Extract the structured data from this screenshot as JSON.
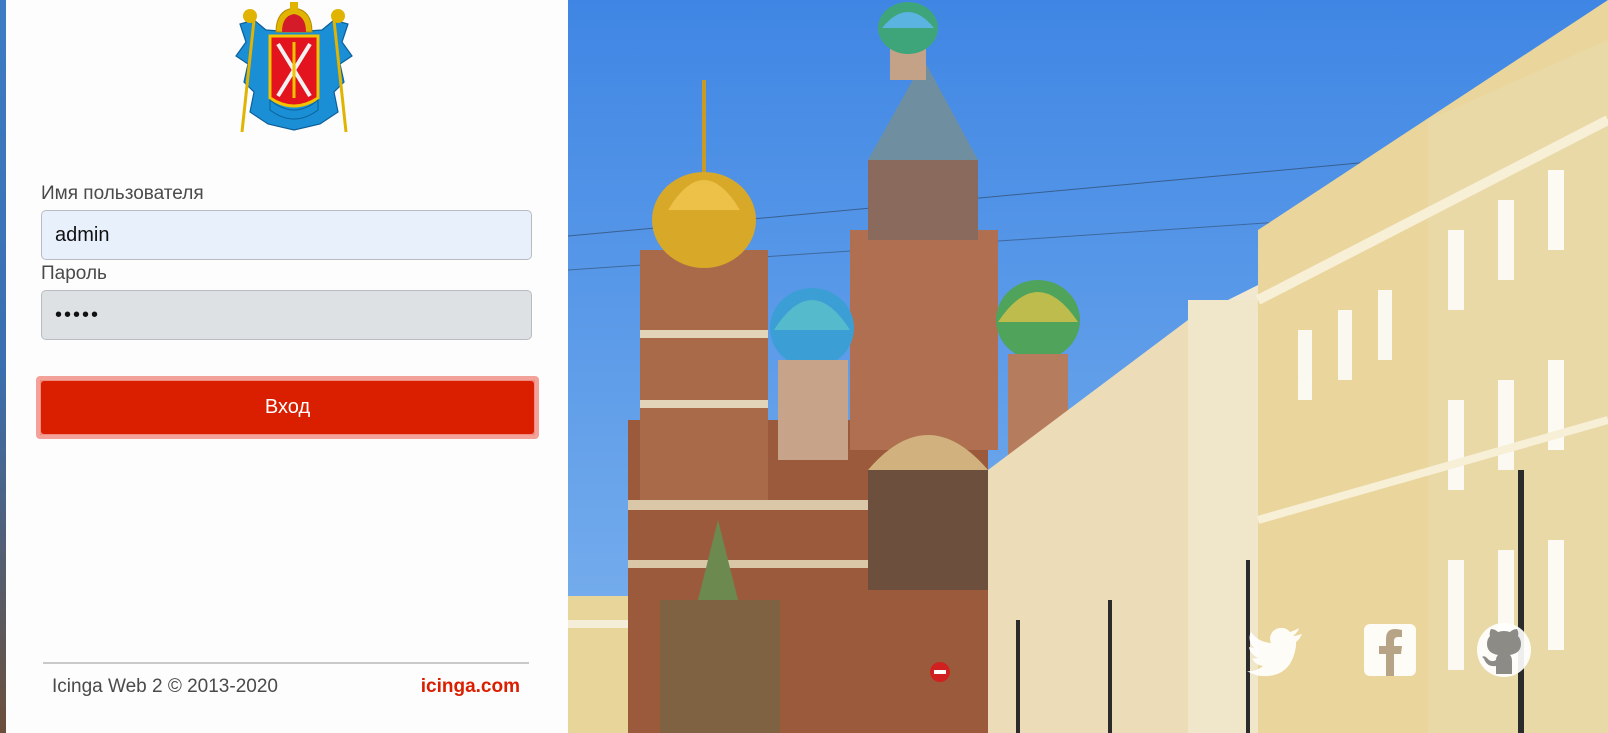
{
  "form": {
    "username_label": "Имя пользователя",
    "username_value": "admin",
    "password_label": "Пароль",
    "password_value": "•••••",
    "submit_label": "Вход"
  },
  "footer": {
    "copyright": "Icinga Web 2 © 2013-2020",
    "link_text": "icinga.com"
  },
  "social": [
    {
      "icon": "twitter-icon"
    },
    {
      "icon": "facebook-icon"
    },
    {
      "icon": "github-icon"
    }
  ],
  "colors": {
    "accent": "#da1e00",
    "input_username_bg": "#e8f0fc",
    "input_password_bg": "#dde1e3",
    "sky": "#4f8fe0"
  }
}
